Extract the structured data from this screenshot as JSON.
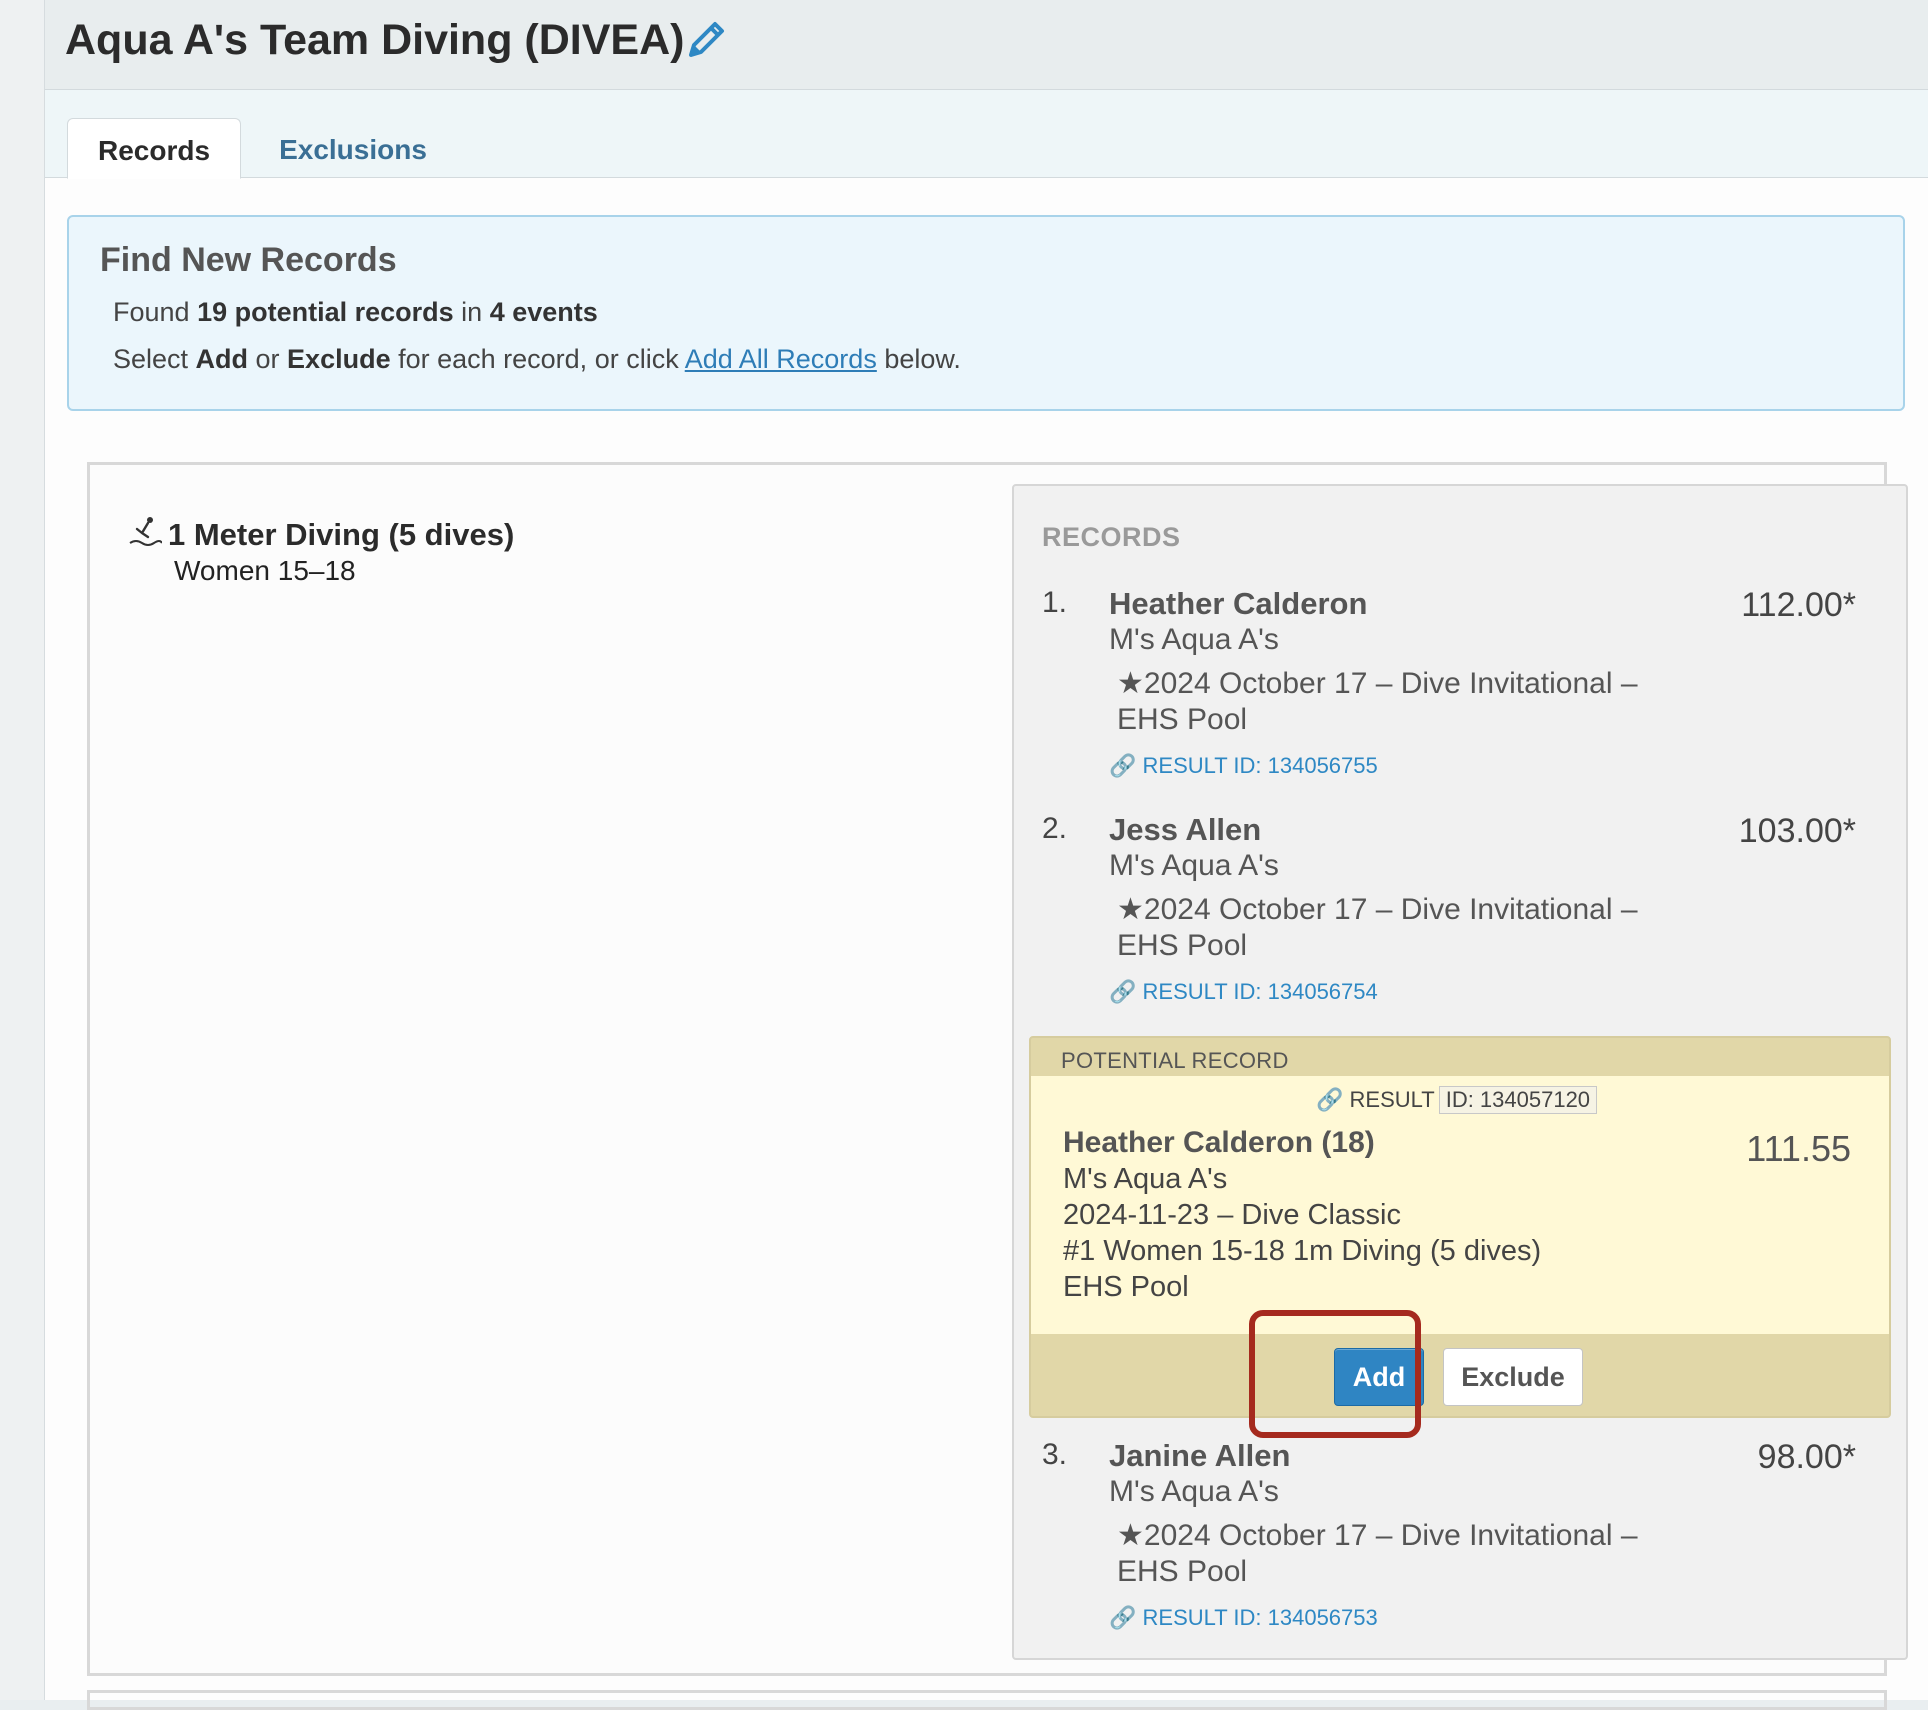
{
  "page": {
    "title": "Aqua A's Team Diving (DIVEA)",
    "tabs": [
      {
        "label": "Records",
        "active": true
      },
      {
        "label": "Exclusions",
        "active": false
      }
    ]
  },
  "find": {
    "title": "Find New Records",
    "line1_a": "Found ",
    "line1_count": "19 potential records",
    "line1_b": " in ",
    "line1_events": "4 events",
    "line2_a": "Select ",
    "line2_add": "Add",
    "line2_b": " or ",
    "line2_exclude": "Exclude",
    "line2_c": " for each record, or click ",
    "line2_link": "Add All Records",
    "line2_d": " below."
  },
  "event": {
    "name": "1 Meter Diving (5 dives)",
    "group": "Women 15–18",
    "icon": "diver-icon"
  },
  "records": {
    "heading": "RECORDS",
    "items": [
      {
        "num": "1.",
        "name": "Heather Calderon",
        "team": "M's Aqua A's",
        "meet": "2024 October 17 – Dive Invitational – EHS Pool",
        "result_id": "RESULT ID: 134056755",
        "score": "112.00*"
      },
      {
        "num": "2.",
        "name": "Jess Allen",
        "team": "M's Aqua A's",
        "meet": "2024 October 17 – Dive Invitational – EHS Pool",
        "result_id": "RESULT ID: 134056754",
        "score": "103.00*"
      },
      {
        "num": "3.",
        "name": "Janine Allen",
        "team": "M's Aqua A's",
        "meet": "2024 October 17 – Dive Invitational – EHS Pool",
        "result_id": "RESULT ID: 134056753",
        "score": "98.00*"
      }
    ]
  },
  "potential": {
    "heading": "POTENTIAL RECORD",
    "result_label": "RESULT",
    "result_id": "ID: 134057120",
    "name": "Heather Calderon (18)",
    "team": "M's Aqua A's",
    "meet": "2024-11-23 – Dive Classic",
    "place_event": "#1 Women 15-18 1m Diving (5 dives)",
    "venue": "EHS Pool",
    "score": "111.55",
    "add_label": "Add",
    "exclude_label": "Exclude"
  },
  "colors": {
    "accent": "#2f85c3",
    "link": "#2e88c4",
    "highlight": "#a52a1e",
    "potential_bg": "#fff9d6"
  }
}
